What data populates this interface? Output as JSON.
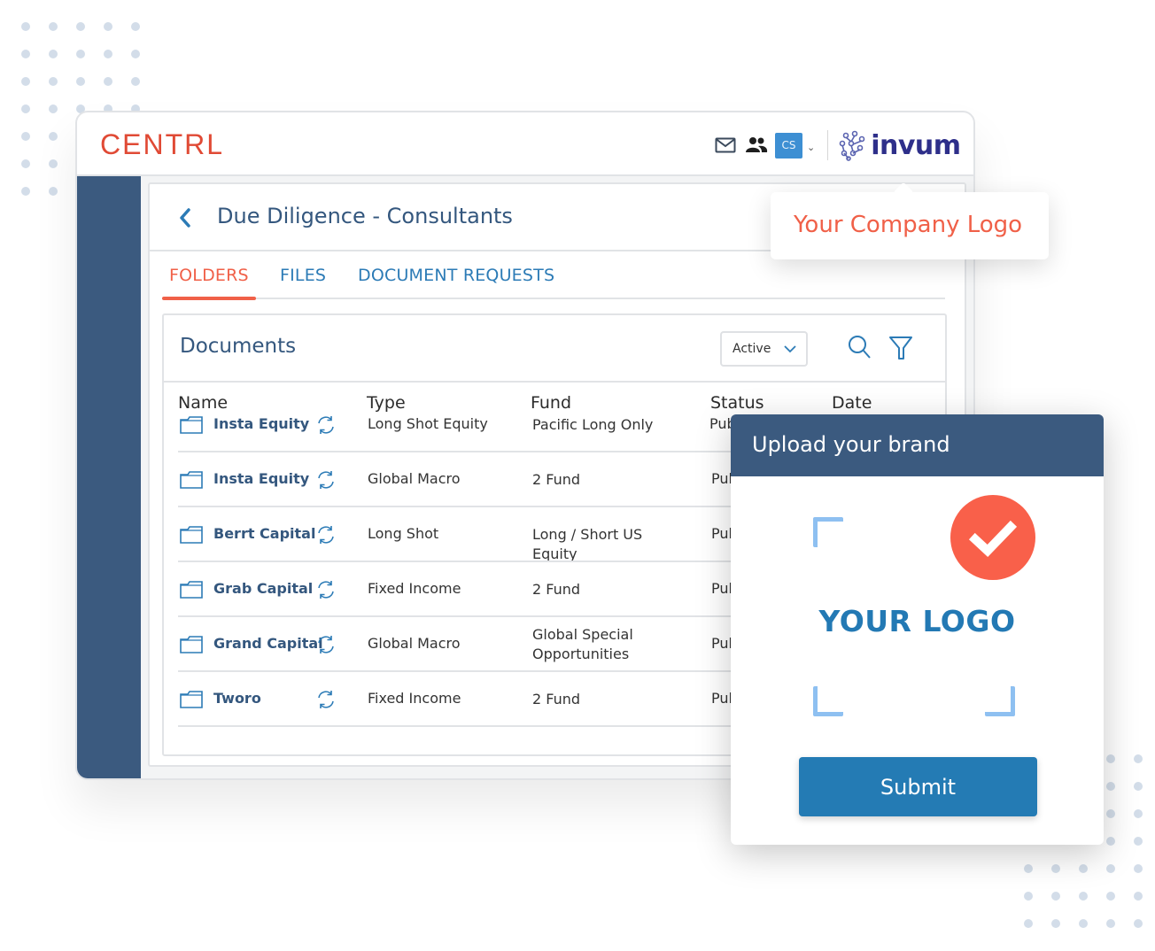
{
  "app": {
    "brand": "CENTRL",
    "partner_logo": "invum",
    "avatar_initials": "CS",
    "icons": [
      "mail-icon",
      "users-icon",
      "chevron-down-icon",
      "invum-network-icon"
    ]
  },
  "page": {
    "title": "Due Diligence - Consultants",
    "back_icon": "chevron-left-icon"
  },
  "tabs": [
    {
      "label": "FOLDERS",
      "active": true
    },
    {
      "label": "FILES",
      "active": false
    },
    {
      "label": "DOCUMENT REQUESTS",
      "active": false
    }
  ],
  "documents": {
    "title": "Documents",
    "status_filter": "Active",
    "icons": [
      "search-icon",
      "filter-icon"
    ],
    "columns": [
      "Name",
      "Type",
      "Fund",
      "Status",
      "Date"
    ],
    "rows": [
      {
        "name": "Insta Equity",
        "type": "Long Shot Equity",
        "fund": "Pacific Long Only",
        "status": "Pub"
      },
      {
        "name": "Insta Equity",
        "type": "Global Macro",
        "fund": "2 Fund",
        "status": "Pub"
      },
      {
        "name": "Berrt Capital",
        "type": "Long Shot",
        "fund": "Long / Short US Equity",
        "status": "Pub"
      },
      {
        "name": "Grab Capital",
        "type": "Fixed Income",
        "fund": "2 Fund",
        "status": "Pub"
      },
      {
        "name": "Grand Capital",
        "type": "Global Macro",
        "fund": "Global Special Opportunities",
        "status": "Pub"
      },
      {
        "name": "Tworo",
        "type": "Fixed Income",
        "fund": "2 Fund",
        "status": "Pul"
      }
    ]
  },
  "tooltip": {
    "text": "Your Company Logo"
  },
  "upload_modal": {
    "title": "Upload your brand",
    "placeholder_logo": "YOUR LOGO",
    "submit_label": "Submit",
    "check_icon": "check-circle-icon"
  },
  "colors": {
    "brand_red": "#e04a35",
    "accent_orange": "#f06048",
    "navy": "#3b5a7f",
    "link_blue": "#2c7bb6",
    "button_blue": "#247bb4",
    "invum_purple": "#2e2f8a"
  }
}
